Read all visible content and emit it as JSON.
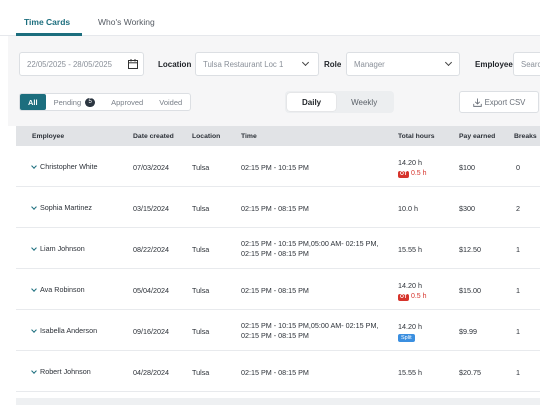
{
  "top_tabs": [
    {
      "label": "Time Cards",
      "active": true
    },
    {
      "label": "Who's Working",
      "active": false
    }
  ],
  "filters": {
    "date_range": "22/05/2025 - 28/05/2025",
    "location_label": "Location",
    "location_value": "Tulsa Restaurant Loc 1",
    "role_label": "Role",
    "role_value": "Manager",
    "employee_label": "Employee",
    "employee_placeholder": "Search"
  },
  "status_tabs": [
    {
      "label": "All",
      "active": true
    },
    {
      "label": "Pending",
      "count": "5",
      "active": false
    },
    {
      "label": "Approved",
      "active": false
    },
    {
      "label": "Voided",
      "active": false
    }
  ],
  "period_tabs": [
    {
      "label": "Daily",
      "active": true
    },
    {
      "label": "Weekly",
      "active": false
    }
  ],
  "export_label": "Export CSV",
  "table": {
    "columns": [
      "Employee",
      "Date created",
      "Location",
      "Time",
      "Total hours",
      "Pay earned",
      "Breaks"
    ],
    "rows": [
      {
        "employee": "Christopher White",
        "date": "07/03/2024",
        "location": "Tulsa",
        "time": [
          "02:15 PM - 10:15 PM"
        ],
        "hours": "14.20 h",
        "ot": "0.5 h",
        "split": null,
        "pay": "$100",
        "breaks": "0"
      },
      {
        "employee": "Sophia Martinez",
        "date": "03/15/2024",
        "location": "Tulsa",
        "time": [
          "02:15 PM - 08:15 PM"
        ],
        "hours": "10.0 h",
        "ot": null,
        "split": null,
        "pay": "$300",
        "breaks": "2"
      },
      {
        "employee": "Liam Johnson",
        "date": "08/22/2024",
        "location": "Tulsa",
        "time": [
          "02:15 PM - 10:15 PM,05:00 AM- 02:15 PM,",
          "02:15 PM - 08:15 PM"
        ],
        "hours": "15.55 h",
        "ot": null,
        "split": null,
        "pay": "$12.50",
        "breaks": "1"
      },
      {
        "employee": "Ava Robinson",
        "date": "05/04/2024",
        "location": "Tulsa",
        "time": [
          "02:15 PM - 08:15 PM"
        ],
        "hours": "14.20 h",
        "ot": "0.5 h",
        "split": null,
        "pay": "$15.00",
        "breaks": "1"
      },
      {
        "employee": "Isabella Anderson",
        "date": "09/16/2024",
        "location": "Tulsa",
        "time": [
          "02:15 PM - 10:15 PM,05:00 AM- 02:15 PM,",
          "02:15 PM - 08:15 PM"
        ],
        "hours": "14.20 h",
        "ot": null,
        "split": "Split",
        "pay": "$9.99",
        "breaks": "1"
      },
      {
        "employee": "Robert Johnson",
        "date": "04/28/2024",
        "location": "Tulsa",
        "time": [
          "02:15 PM - 08:15 PM"
        ],
        "hours": "15.55 h",
        "ot": null,
        "split": null,
        "pay": "$20.75",
        "breaks": "1"
      }
    ],
    "ot_badge": "OT"
  },
  "colors": {
    "accent": "#1c6e7e",
    "ot": "#d6342c",
    "split": "#3b8fe0"
  }
}
